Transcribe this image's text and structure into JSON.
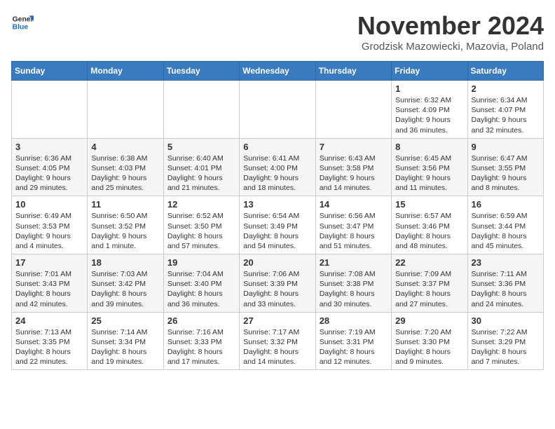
{
  "header": {
    "logo_line1": "General",
    "logo_line2": "Blue",
    "month": "November 2024",
    "location": "Grodzisk Mazowiecki, Mazovia, Poland"
  },
  "weekdays": [
    "Sunday",
    "Monday",
    "Tuesday",
    "Wednesday",
    "Thursday",
    "Friday",
    "Saturday"
  ],
  "weeks": [
    [
      {
        "day": "",
        "info": ""
      },
      {
        "day": "",
        "info": ""
      },
      {
        "day": "",
        "info": ""
      },
      {
        "day": "",
        "info": ""
      },
      {
        "day": "",
        "info": ""
      },
      {
        "day": "1",
        "info": "Sunrise: 6:32 AM\nSunset: 4:09 PM\nDaylight: 9 hours\nand 36 minutes."
      },
      {
        "day": "2",
        "info": "Sunrise: 6:34 AM\nSunset: 4:07 PM\nDaylight: 9 hours\nand 32 minutes."
      }
    ],
    [
      {
        "day": "3",
        "info": "Sunrise: 6:36 AM\nSunset: 4:05 PM\nDaylight: 9 hours\nand 29 minutes."
      },
      {
        "day": "4",
        "info": "Sunrise: 6:38 AM\nSunset: 4:03 PM\nDaylight: 9 hours\nand 25 minutes."
      },
      {
        "day": "5",
        "info": "Sunrise: 6:40 AM\nSunset: 4:01 PM\nDaylight: 9 hours\nand 21 minutes."
      },
      {
        "day": "6",
        "info": "Sunrise: 6:41 AM\nSunset: 4:00 PM\nDaylight: 9 hours\nand 18 minutes."
      },
      {
        "day": "7",
        "info": "Sunrise: 6:43 AM\nSunset: 3:58 PM\nDaylight: 9 hours\nand 14 minutes."
      },
      {
        "day": "8",
        "info": "Sunrise: 6:45 AM\nSunset: 3:56 PM\nDaylight: 9 hours\nand 11 minutes."
      },
      {
        "day": "9",
        "info": "Sunrise: 6:47 AM\nSunset: 3:55 PM\nDaylight: 9 hours\nand 8 minutes."
      }
    ],
    [
      {
        "day": "10",
        "info": "Sunrise: 6:49 AM\nSunset: 3:53 PM\nDaylight: 9 hours\nand 4 minutes."
      },
      {
        "day": "11",
        "info": "Sunrise: 6:50 AM\nSunset: 3:52 PM\nDaylight: 9 hours\nand 1 minute."
      },
      {
        "day": "12",
        "info": "Sunrise: 6:52 AM\nSunset: 3:50 PM\nDaylight: 8 hours\nand 57 minutes."
      },
      {
        "day": "13",
        "info": "Sunrise: 6:54 AM\nSunset: 3:49 PM\nDaylight: 8 hours\nand 54 minutes."
      },
      {
        "day": "14",
        "info": "Sunrise: 6:56 AM\nSunset: 3:47 PM\nDaylight: 8 hours\nand 51 minutes."
      },
      {
        "day": "15",
        "info": "Sunrise: 6:57 AM\nSunset: 3:46 PM\nDaylight: 8 hours\nand 48 minutes."
      },
      {
        "day": "16",
        "info": "Sunrise: 6:59 AM\nSunset: 3:44 PM\nDaylight: 8 hours\nand 45 minutes."
      }
    ],
    [
      {
        "day": "17",
        "info": "Sunrise: 7:01 AM\nSunset: 3:43 PM\nDaylight: 8 hours\nand 42 minutes."
      },
      {
        "day": "18",
        "info": "Sunrise: 7:03 AM\nSunset: 3:42 PM\nDaylight: 8 hours\nand 39 minutes."
      },
      {
        "day": "19",
        "info": "Sunrise: 7:04 AM\nSunset: 3:40 PM\nDaylight: 8 hours\nand 36 minutes."
      },
      {
        "day": "20",
        "info": "Sunrise: 7:06 AM\nSunset: 3:39 PM\nDaylight: 8 hours\nand 33 minutes."
      },
      {
        "day": "21",
        "info": "Sunrise: 7:08 AM\nSunset: 3:38 PM\nDaylight: 8 hours\nand 30 minutes."
      },
      {
        "day": "22",
        "info": "Sunrise: 7:09 AM\nSunset: 3:37 PM\nDaylight: 8 hours\nand 27 minutes."
      },
      {
        "day": "23",
        "info": "Sunrise: 7:11 AM\nSunset: 3:36 PM\nDaylight: 8 hours\nand 24 minutes."
      }
    ],
    [
      {
        "day": "24",
        "info": "Sunrise: 7:13 AM\nSunset: 3:35 PM\nDaylight: 8 hours\nand 22 minutes."
      },
      {
        "day": "25",
        "info": "Sunrise: 7:14 AM\nSunset: 3:34 PM\nDaylight: 8 hours\nand 19 minutes."
      },
      {
        "day": "26",
        "info": "Sunrise: 7:16 AM\nSunset: 3:33 PM\nDaylight: 8 hours\nand 17 minutes."
      },
      {
        "day": "27",
        "info": "Sunrise: 7:17 AM\nSunset: 3:32 PM\nDaylight: 8 hours\nand 14 minutes."
      },
      {
        "day": "28",
        "info": "Sunrise: 7:19 AM\nSunset: 3:31 PM\nDaylight: 8 hours\nand 12 minutes."
      },
      {
        "day": "29",
        "info": "Sunrise: 7:20 AM\nSunset: 3:30 PM\nDaylight: 8 hours\nand 9 minutes."
      },
      {
        "day": "30",
        "info": "Sunrise: 7:22 AM\nSunset: 3:29 PM\nDaylight: 8 hours\nand 7 minutes."
      }
    ]
  ]
}
